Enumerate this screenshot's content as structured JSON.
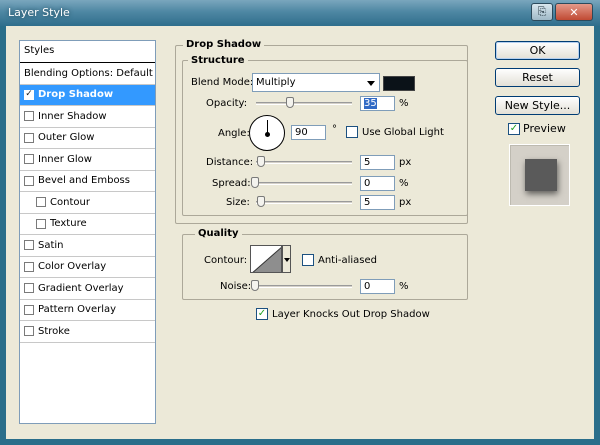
{
  "window": {
    "title": "Layer Style",
    "help_glyph": "⎘",
    "close_glyph": "✕"
  },
  "styles_panel": {
    "header": "Styles",
    "items": [
      {
        "label": "Blending Options: Default",
        "checkbox": false,
        "checked": false,
        "selected": false,
        "indent": false
      },
      {
        "label": "Drop Shadow",
        "checkbox": true,
        "checked": true,
        "selected": true,
        "indent": false
      },
      {
        "label": "Inner Shadow",
        "checkbox": true,
        "checked": false,
        "selected": false,
        "indent": false
      },
      {
        "label": "Outer Glow",
        "checkbox": true,
        "checked": false,
        "selected": false,
        "indent": false
      },
      {
        "label": "Inner Glow",
        "checkbox": true,
        "checked": false,
        "selected": false,
        "indent": false
      },
      {
        "label": "Bevel and Emboss",
        "checkbox": true,
        "checked": false,
        "selected": false,
        "indent": false
      },
      {
        "label": "Contour",
        "checkbox": true,
        "checked": false,
        "selected": false,
        "indent": true
      },
      {
        "label": "Texture",
        "checkbox": true,
        "checked": false,
        "selected": false,
        "indent": true
      },
      {
        "label": "Satin",
        "checkbox": true,
        "checked": false,
        "selected": false,
        "indent": false
      },
      {
        "label": "Color Overlay",
        "checkbox": true,
        "checked": false,
        "selected": false,
        "indent": false
      },
      {
        "label": "Gradient Overlay",
        "checkbox": true,
        "checked": false,
        "selected": false,
        "indent": false
      },
      {
        "label": "Pattern Overlay",
        "checkbox": true,
        "checked": false,
        "selected": false,
        "indent": false
      },
      {
        "label": "Stroke",
        "checkbox": true,
        "checked": false,
        "selected": false,
        "indent": false
      }
    ]
  },
  "drop_shadow": {
    "section_title": "Drop Shadow",
    "structure_title": "Structure",
    "blend_mode_label": "Blend Mode:",
    "blend_mode_value": "Multiply",
    "shadow_color": "#0b1218",
    "opacity_label": "Opacity:",
    "opacity_value": "35",
    "opacity_unit": "%",
    "opacity_fraction": 0.35,
    "angle_label": "Angle:",
    "angle_value": "90",
    "angle_unit": "°",
    "use_global_light_label": "Use Global Light",
    "use_global_light_checked": false,
    "distance_label": "Distance:",
    "distance_value": "5",
    "distance_unit": "px",
    "spread_label": "Spread:",
    "spread_value": "0",
    "spread_unit": "%",
    "size_label": "Size:",
    "size_value": "5",
    "size_unit": "px",
    "quality_title": "Quality",
    "contour_label": "Contour:",
    "anti_aliased_label": "Anti-aliased",
    "anti_aliased_checked": false,
    "noise_label": "Noise:",
    "noise_value": "0",
    "noise_unit": "%",
    "knockout_label": "Layer Knocks Out Drop Shadow",
    "knockout_checked": true
  },
  "buttons": {
    "ok": "OK",
    "reset": "Reset",
    "new_style": "New Style...",
    "preview_label": "Preview",
    "preview_checked": true
  },
  "colors": {
    "selection": "#3399ff",
    "dialog_bg": "#ece9d8"
  }
}
